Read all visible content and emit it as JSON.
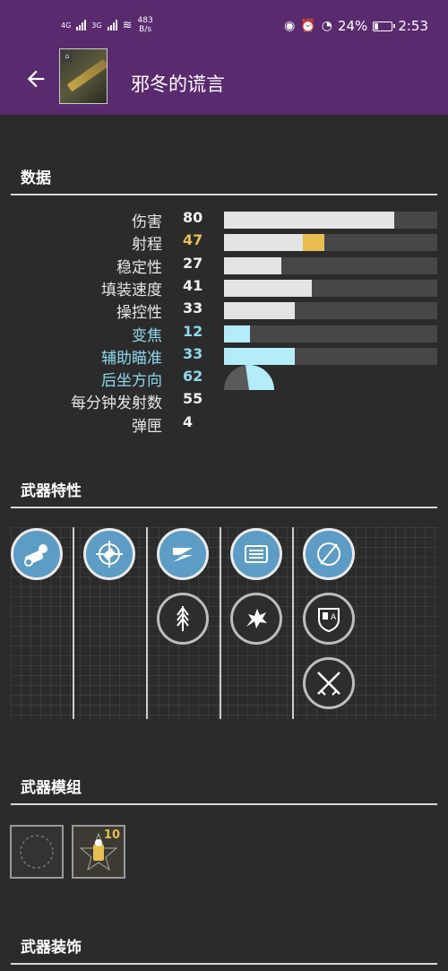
{
  "status_bar": {
    "network1": "4G",
    "network2": "3G",
    "speed_value": "483",
    "speed_unit": "B/s",
    "battery": "24%",
    "time": "2:53"
  },
  "app_bar": {
    "back_icon": "arrow-left",
    "title": "邪冬的谎言"
  },
  "sections": {
    "stats": "数据",
    "perks": "武器特性",
    "mods": "武器模组",
    "ornaments": "武器装饰"
  },
  "stats": [
    {
      "label": "伤害",
      "value": "80",
      "fill": 0.8,
      "style": "normal"
    },
    {
      "label": "射程",
      "value": "47",
      "fill": 0.37,
      "bonus": 0.1,
      "style": "gold"
    },
    {
      "label": "稳定性",
      "value": "27",
      "fill": 0.27,
      "style": "normal"
    },
    {
      "label": "填装速度",
      "value": "41",
      "fill": 0.41,
      "style": "normal"
    },
    {
      "label": "操控性",
      "value": "33",
      "fill": 0.33,
      "style": "normal"
    },
    {
      "label": "变焦",
      "value": "12",
      "fill": 0.12,
      "style": "blue"
    },
    {
      "label": "辅助瞄准",
      "value": "33",
      "fill": 0.33,
      "style": "blue"
    },
    {
      "label": "后坐方向",
      "value": "62",
      "style": "recoil"
    },
    {
      "label": "每分钟发射数",
      "value": "55",
      "style": "text"
    },
    {
      "label": "弹匣",
      "value": "4",
      "style": "text"
    }
  ],
  "perks": [
    {
      "column": 1,
      "items": [
        {
          "icon": "grenade-launcher-icon",
          "active": true
        }
      ]
    },
    {
      "column": 2,
      "items": [
        {
          "icon": "crosshair-barrel-icon",
          "active": true
        }
      ]
    },
    {
      "column": 3,
      "items": [
        {
          "icon": "lightning-rounds-icon",
          "active": true
        },
        {
          "icon": "feather-arrow-icon",
          "active": false
        }
      ]
    },
    {
      "column": 4,
      "items": [
        {
          "icon": "magazine-icon",
          "active": true
        },
        {
          "icon": "dragon-icon",
          "active": false
        }
      ]
    },
    {
      "column": 5,
      "items": [
        {
          "icon": "circle-slash-icon",
          "active": true
        },
        {
          "icon": "shield-crest-icon",
          "active": false
        },
        {
          "icon": "crossed-swords-icon",
          "active": false
        }
      ]
    }
  ],
  "mods": [
    {
      "icon": "empty-mod-socket-icon",
      "count": ""
    },
    {
      "icon": "masterwork-icon",
      "count": "10"
    }
  ],
  "colors": {
    "header_purple": "#5a2a6e",
    "background": "#2b2b2b",
    "gold": "#e8be52",
    "blue_text": "#8fd8ee",
    "blue_fill": "#b4ecfa",
    "perk_active": "#5d9cc4"
  }
}
